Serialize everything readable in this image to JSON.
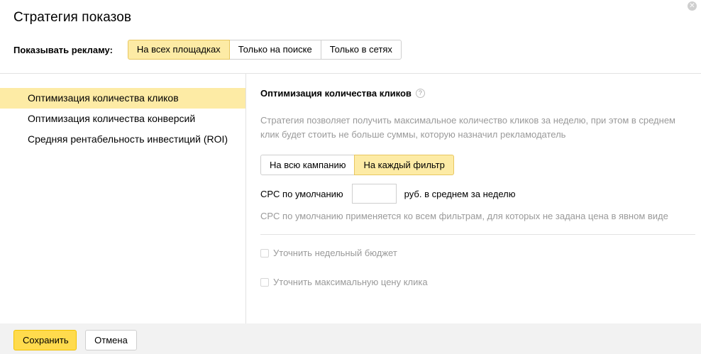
{
  "dialog": {
    "title": "Стратегия показов",
    "close_glyph": "✕"
  },
  "show": {
    "label": "Показывать рекламу:",
    "options": [
      "На всех площадках",
      "Только на поиске",
      "Только в сетях"
    ],
    "selected_index": 0
  },
  "strategies": {
    "items": [
      "Оптимизация количества кликов",
      "Оптимизация количества конверсий",
      "Средняя рентабельность инвестиций (ROI)"
    ],
    "selected_index": 0
  },
  "details": {
    "title": "Оптимизация количества кликов",
    "help_glyph": "?",
    "description": "Стратегия позволяет получить максимальное количество кликов за неделю, при этом в среднем клик будет стоить не больше суммы, которую назначил рекламодатель",
    "scope_options": [
      "На всю кампанию",
      "На каждый фильтр"
    ],
    "scope_selected_index": 1,
    "cpc_label": "CPC по умолчанию",
    "cpc_value": "",
    "cpc_suffix": "руб. в среднем за неделю",
    "cpc_hint": "CPC по умолчанию применяется ко всем фильтрам, для которых не задана цена в явном виде",
    "weekly_budget_label": "Уточнить недельный бюджет",
    "max_click_price_label": "Уточнить максимальную цену клика"
  },
  "footer": {
    "save_label": "Сохранить",
    "cancel_label": "Отмена"
  },
  "colors": {
    "accent_yellow": "#ffdb4d",
    "selected_bg": "#fdeba5",
    "muted_text": "#9a9a9a",
    "border": "#cfcfcf"
  }
}
